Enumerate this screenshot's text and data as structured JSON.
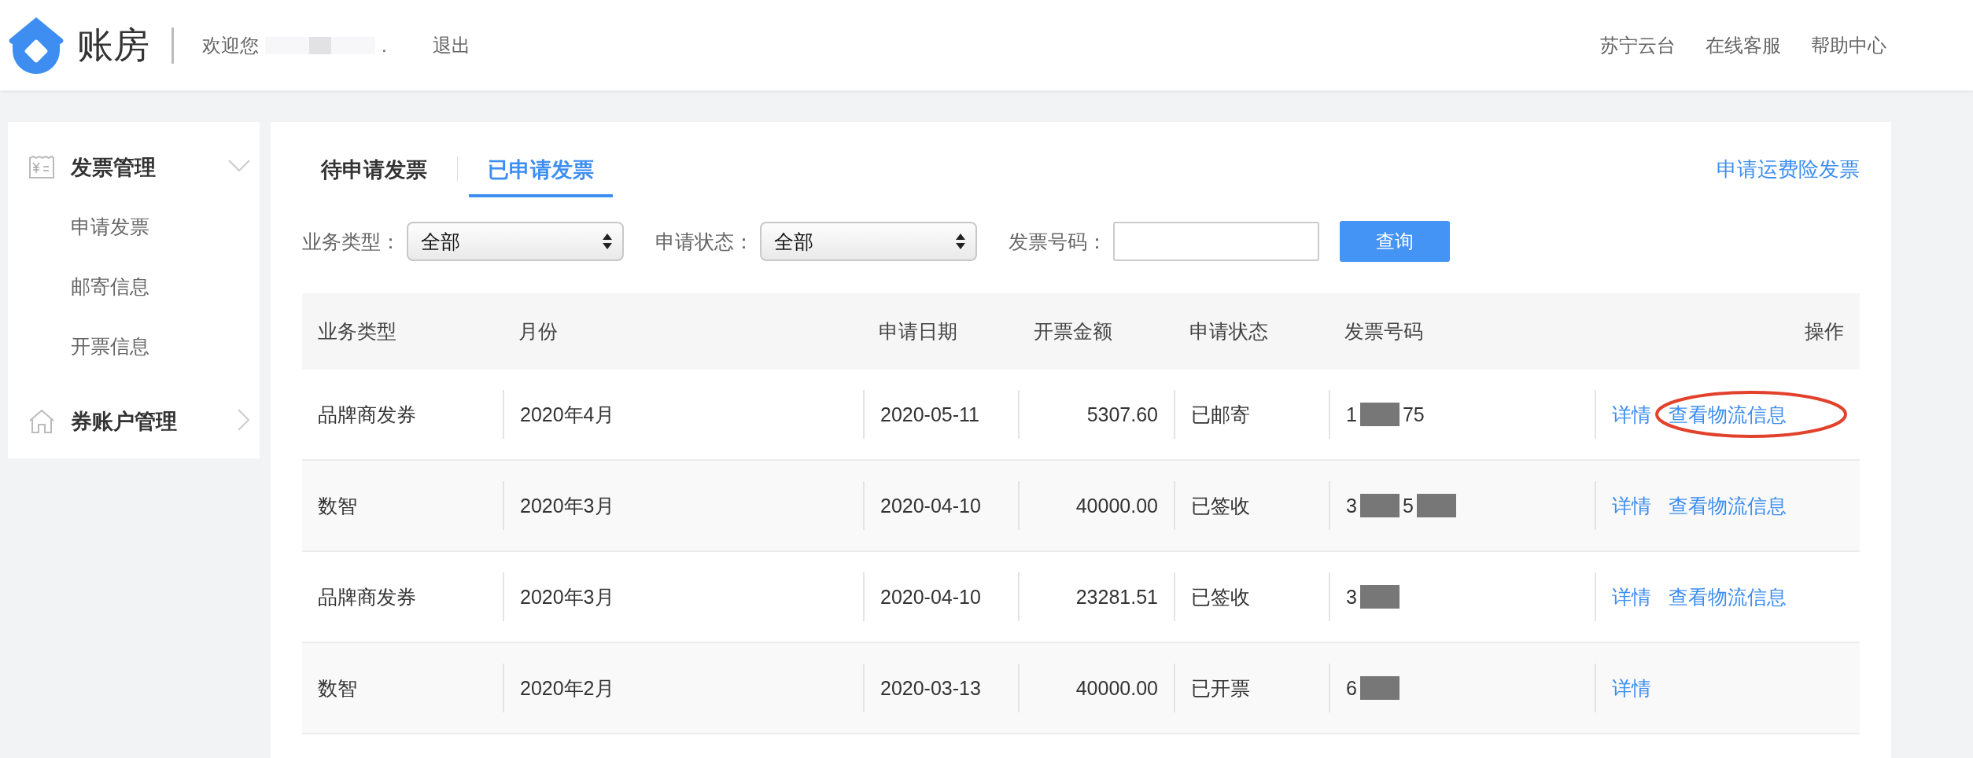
{
  "header": {
    "logo": "账房",
    "welcome": "欢迎您",
    "welcome_suffix": ".",
    "logout": "退出",
    "links": [
      "苏宁云台",
      "在线客服",
      "帮助中心"
    ]
  },
  "sidebar": {
    "groups": [
      {
        "kind": "receipt",
        "title": "发票管理",
        "expanded": true,
        "items": [
          "申请发票",
          "邮寄信息",
          "开票信息"
        ]
      },
      {
        "kind": "house",
        "title": "券账户管理",
        "expanded": false
      }
    ]
  },
  "tabs": [
    {
      "label": "待申请发票",
      "selected": false
    },
    {
      "label": "已申请发票",
      "selected": true
    }
  ],
  "action_link": "申请运费险发票",
  "filters": [
    {
      "kind": "select",
      "label": "业务类型：",
      "value": "全部"
    },
    {
      "kind": "select",
      "label": "申请状态：",
      "value": "全部"
    },
    {
      "kind": "input",
      "label": "发票号码："
    }
  ],
  "search_button": "查询",
  "table": {
    "columns": [
      "业务类型",
      "月份",
      "申请日期",
      "开票金额",
      "申请状态",
      "发票号码",
      "操作"
    ],
    "rows": [
      {
        "cells": [
          "品牌商发券",
          "2020年4月",
          "2020-05-11",
          "5307.60",
          "已邮寄"
        ],
        "invoice_number": [
          {
            "kind": "text",
            "text": "1"
          },
          {
            "kind": "redacted"
          },
          {
            "kind": "text",
            "text": "75"
          }
        ],
        "actions": [
          "详情",
          "查看物流信息"
        ],
        "annotated": true
      },
      {
        "cells": [
          "数智",
          "2020年3月",
          "2020-04-10",
          "40000.00",
          "已签收"
        ],
        "invoice_number": [
          {
            "kind": "text",
            "text": "3"
          },
          {
            "kind": "redacted"
          },
          {
            "kind": "text",
            "text": "5"
          },
          {
            "kind": "redacted"
          }
        ],
        "actions": [
          "详情",
          "查看物流信息"
        ],
        "annotated": false
      },
      {
        "cells": [
          "品牌商发券",
          "2020年3月",
          "2020-04-10",
          "23281.51",
          "已签收"
        ],
        "invoice_number": [
          {
            "kind": "text",
            "text": "3"
          },
          {
            "kind": "redacted"
          }
        ],
        "actions": [
          "详情",
          "查看物流信息"
        ],
        "annotated": false
      },
      {
        "cells": [
          "数智",
          "2020年2月",
          "2020-03-13",
          "40000.00",
          "已开票"
        ],
        "invoice_number": [
          {
            "kind": "text",
            "text": "6"
          },
          {
            "kind": "redacted"
          }
        ],
        "actions": [
          "详情"
        ],
        "annotated": false
      }
    ]
  }
}
